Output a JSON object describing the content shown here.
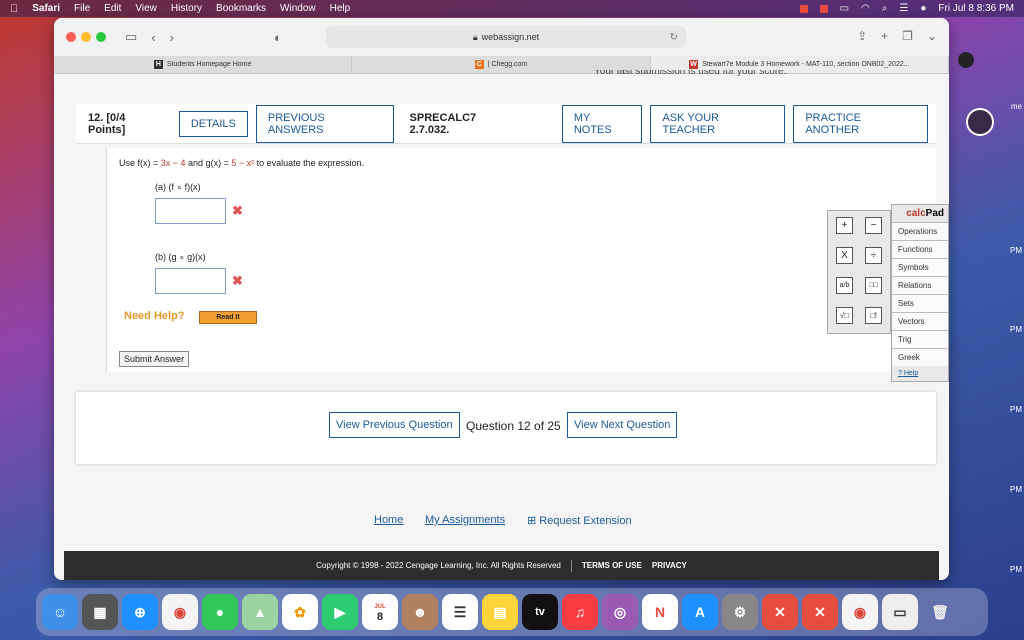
{
  "menubar": {
    "app": "Safari",
    "items": [
      "File",
      "Edit",
      "View",
      "History",
      "Bookmarks",
      "Window",
      "Help"
    ],
    "clock": "Fri Jul 8  8:36 PM"
  },
  "browser": {
    "url": "webassign.net",
    "tabs": [
      {
        "label": "Students Homepage Home"
      },
      {
        "label": "| Chegg.com"
      },
      {
        "label": "Stewart7e Module 3 Homework - MAT-110, section ONB02_2022..."
      }
    ],
    "partial_text": "Your last submission is used for your score."
  },
  "question": {
    "number": "12.",
    "points": "[0/4 Points]",
    "buttons": {
      "details": "DETAILS",
      "previous_answers": "PREVIOUS ANSWERS",
      "my_notes": "MY NOTES",
      "ask_teacher": "ASK YOUR TEACHER",
      "practice": "PRACTICE ANOTHER"
    },
    "code": "SPRECALC7 2.7.032.",
    "prompt_pre": "Use  f(x) = ",
    "prompt_f": "3x − 4",
    "prompt_mid": "  and  g(x) = ",
    "prompt_g": "5 − x²",
    "prompt_post": "  to evaluate the expression.",
    "part_a": "(a)     (f ∘ f)(x)",
    "part_b": "(b)     (g ∘ g)(x)",
    "need_help": "Need Help?",
    "read_it": "Read It",
    "submit": "Submit Answer"
  },
  "calcpad": {
    "title_a": "calc",
    "title_b": "Pad",
    "menu": [
      "Operations",
      "Functions",
      "Symbols",
      "Relations",
      "Sets",
      "Vectors",
      "Trig",
      "Greek"
    ],
    "help": "Help",
    "keys": [
      "+",
      "−",
      "X",
      "÷",
      "a/b",
      "□□",
      "√□",
      "□!"
    ]
  },
  "nav": {
    "prev": "View Previous Question",
    "counter": "Question 12 of 25",
    "next": "View Next Question"
  },
  "links": {
    "home": "Home",
    "assignments": "My Assignments",
    "extension": "Request Extension"
  },
  "footer": {
    "copyright": "Copyright © 1998 - 2022 Cengage Learning, Inc. All Rights Reserved",
    "terms": "TERMS OF USE",
    "privacy": "PRIVACY"
  },
  "desktop": {
    "side_label": "me",
    "pm": "PM"
  },
  "dock": {
    "calendar_month": "JUL",
    "calendar_day": "8",
    "tv": "tv"
  }
}
